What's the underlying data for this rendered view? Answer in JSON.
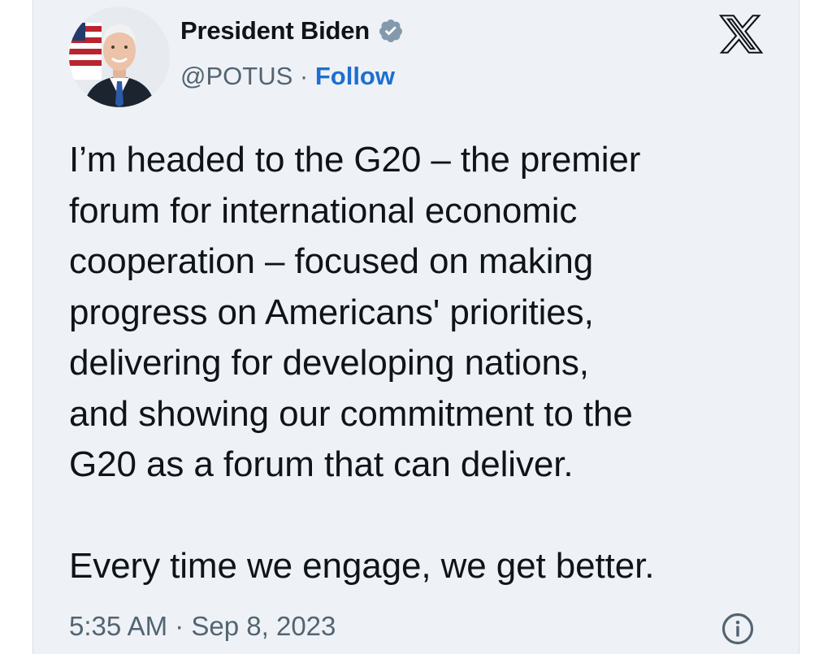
{
  "author": {
    "display_name": "President Biden",
    "handle": "@POTUS",
    "separator": " · ",
    "follow_label": "Follow",
    "verified_color": "#829aab"
  },
  "tweet": {
    "paragraph_1": "I’m headed to the G20 – the premier\nforum for international economic\ncooperation – focused on making\nprogress on Americans' priorities,\ndelivering for developing nations,\nand showing our commitment to the\nG20 as a forum that can deliver.",
    "paragraph_2": "Every time we engage, we get better.",
    "timestamp": "5:35 AM · Sep 8, 2023"
  },
  "icons": {
    "brand": "x-logo-icon",
    "verified": "verified-badge-icon",
    "info": "info-icon"
  },
  "colors": {
    "card_background": "#eef2f6",
    "text": "#0f1419",
    "secondary_text": "#536471",
    "follow_link": "#1d6fd1"
  }
}
